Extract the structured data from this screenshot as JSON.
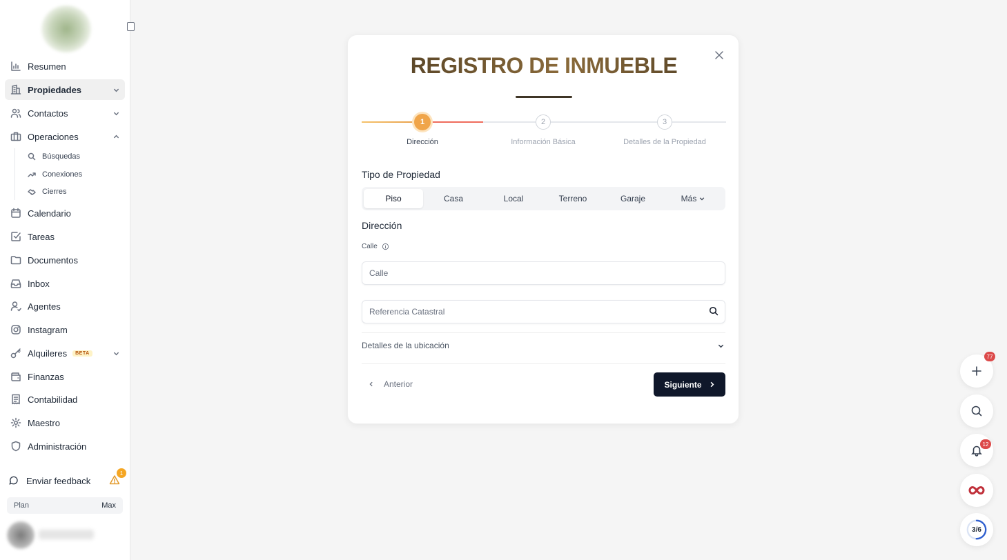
{
  "sidebar": {
    "items": [
      {
        "label": "Resumen",
        "icon": "chart-icon"
      },
      {
        "label": "Propiedades",
        "icon": "building-icon",
        "expandable": true,
        "active": true
      },
      {
        "label": "Contactos",
        "icon": "users-icon",
        "expandable": true
      },
      {
        "label": "Operaciones",
        "icon": "briefcase-icon",
        "expandable": true,
        "expanded": true
      },
      {
        "label": "Calendario",
        "icon": "calendar-icon"
      },
      {
        "label": "Tareas",
        "icon": "checkbox-icon"
      },
      {
        "label": "Documentos",
        "icon": "folder-icon"
      },
      {
        "label": "Inbox",
        "icon": "inbox-icon"
      },
      {
        "label": "Agentes",
        "icon": "user-icon"
      },
      {
        "label": "Instagram",
        "icon": "instagram-icon"
      },
      {
        "label": "Alquileres",
        "icon": "key-icon",
        "badge": "BETA",
        "expandable": true
      },
      {
        "label": "Finanzas",
        "icon": "wallet-icon"
      },
      {
        "label": "Contabilidad",
        "icon": "ledger-icon"
      },
      {
        "label": "Maestro",
        "icon": "gear-icon"
      },
      {
        "label": "Administración",
        "icon": "shield-icon"
      }
    ],
    "sub_items": [
      {
        "label": "Búsquedas",
        "icon": "search-icon"
      },
      {
        "label": "Conexiones",
        "icon": "trend-icon"
      },
      {
        "label": "Cierres",
        "icon": "handshake-icon"
      }
    ],
    "feedback": {
      "label": "Enviar feedback",
      "warning_count": "1"
    },
    "plan": {
      "label": "Plan",
      "value": "Max"
    }
  },
  "modal": {
    "title": "REGISTRO DE INMUEBLE",
    "steps": [
      {
        "number": "1",
        "label": "Dirección",
        "active": true
      },
      {
        "number": "2",
        "label": "Información Básica"
      },
      {
        "number": "3",
        "label": "Detalles de la Propiedad"
      }
    ],
    "property_type_title": "Tipo de Propiedad",
    "property_types": [
      "Piso",
      "Casa",
      "Local",
      "Terreno",
      "Garaje",
      "Más"
    ],
    "selected_type": "Piso",
    "address_title": "Dirección",
    "street_label": "Calle",
    "street_placeholder": "Calle",
    "street_value": "",
    "cadastral_placeholder": "Referencia Catastral",
    "cadastral_value": "",
    "location_details": "Detalles de la ubicación",
    "prev_label": "Anterior",
    "next_label": "Siguiente"
  },
  "fabs": {
    "add_badge": "77",
    "notifications_badge": "12",
    "progress": "3/6"
  },
  "colors": {
    "accent": "#f0a54a",
    "step_progress": "#ef6b5b",
    "primary_button": "#0f172a",
    "badge": "#dc4a4a"
  }
}
